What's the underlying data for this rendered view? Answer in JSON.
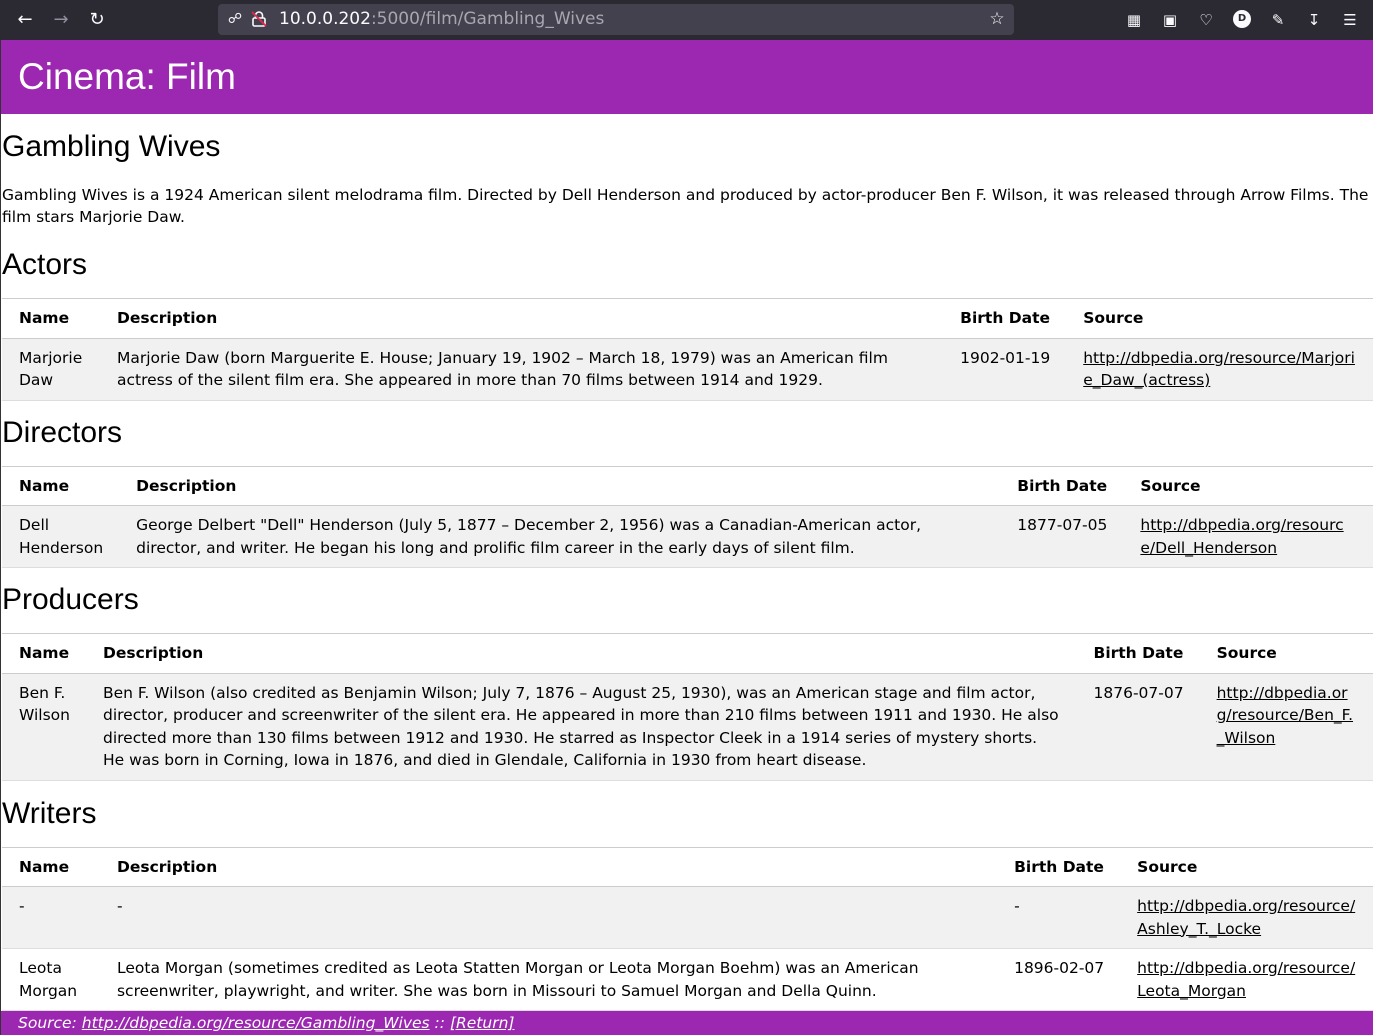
{
  "browser": {
    "url_host": "10.0.0.202",
    "url_path": ":5000/film/Gambling_Wives"
  },
  "header": {
    "title": "Cinema: Film"
  },
  "film": {
    "title": "Gambling Wives",
    "abstract": "Gambling Wives is a 1924 American silent melodrama film. Directed by Dell Henderson and produced by actor-producer Ben F. Wilson, it was released through Arrow Films. The film stars Marjorie Daw."
  },
  "columns": {
    "name": "Name",
    "description": "Description",
    "birth_date": "Birth Date",
    "source": "Source"
  },
  "sections": [
    {
      "title": "Actors",
      "rows": [
        {
          "name": "Marjorie Daw",
          "description": "Marjorie Daw (born Marguerite E. House; January 19, 1902 – March 18, 1979) was an American film actress of the silent film era. She appeared in more than 70 films between 1914 and 1929.",
          "birth_date": "1902-01-19",
          "source": "http://dbpedia.org/resource/Marjorie_Daw_(actress)"
        }
      ]
    },
    {
      "title": "Directors",
      "rows": [
        {
          "name": "Dell Henderson",
          "description": "George Delbert \"Dell\" Henderson (July 5, 1877 – December 2, 1956) was a Canadian-American actor, director, and writer. He began his long and prolific film career in the early days of silent film.",
          "birth_date": "1877-07-05",
          "source": "http://dbpedia.org/resource/Dell_Henderson"
        }
      ]
    },
    {
      "title": "Producers",
      "rows": [
        {
          "name": "Ben F. Wilson",
          "description": "Ben F. Wilson (also credited as Benjamin Wilson; July 7, 1876 – August 25, 1930), was an American stage and film actor, director, producer and screenwriter of the silent era. He appeared in more than 210 films between 1911 and 1930. He also directed more than 130 films between 1912 and 1930. He starred as Inspector Cleek in a 1914 series of mystery shorts. He was born in Corning, Iowa in 1876, and died in Glendale, California in 1930 from heart disease.",
          "birth_date": "1876-07-07",
          "source": "http://dbpedia.org/resource/Ben_F._Wilson"
        }
      ]
    },
    {
      "title": "Writers",
      "rows": [
        {
          "name": "-",
          "description": "-",
          "birth_date": "-",
          "source": "http://dbpedia.org/resource/Ashley_T._Locke"
        },
        {
          "name": "Leota Morgan",
          "description": "Leota Morgan (sometimes credited as Leota Statten Morgan or Leota Morgan Boehm) was an American screenwriter, playwright, and writer. She was born in Missouri to Samuel Morgan and Della Quinn.",
          "birth_date": "1896-02-07",
          "source": "http://dbpedia.org/resource/Leota_Morgan"
        }
      ]
    }
  ],
  "footer": {
    "source_label": "Source:",
    "source_url": "http://dbpedia.org/resource/Gambling_Wives",
    "separator": "::",
    "return_label": "[Return]"
  },
  "colors": {
    "header_bg": "#9c27b0",
    "chrome_bg": "#2b2a33",
    "urlbar_bg": "#42414d"
  },
  "icons": [
    "back-arrow-icon",
    "forward-arrow-icon",
    "reload-icon",
    "shield-icon",
    "lock-icon",
    "star-icon",
    "tab-manager-icon",
    "container-icon",
    "pocket-icon",
    "account-avatar-icon",
    "extensions-icon",
    "download-icon",
    "menu-icon"
  ]
}
